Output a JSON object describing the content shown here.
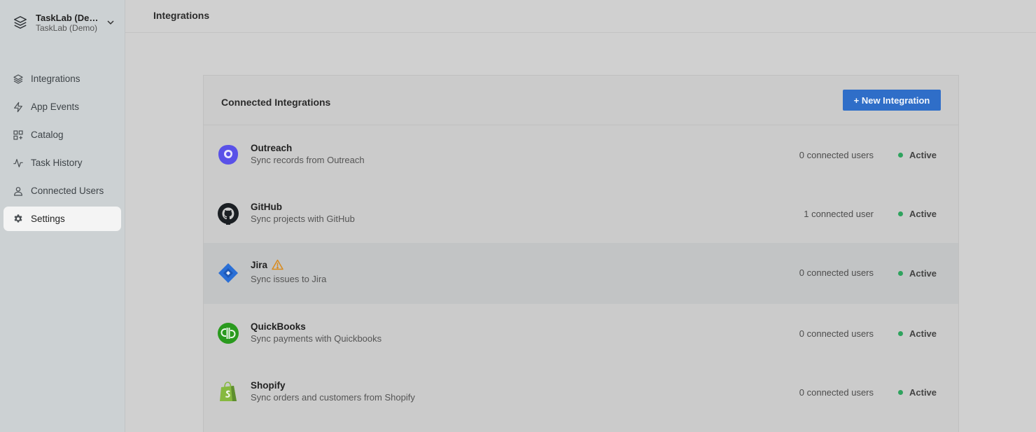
{
  "workspace": {
    "name": "TaskLab (Demo)",
    "subtitle": "TaskLab (Demo)"
  },
  "nav": [
    {
      "label": "Integrations",
      "icon": "layers-icon"
    },
    {
      "label": "App Events",
      "icon": "bolt-icon"
    },
    {
      "label": "Catalog",
      "icon": "grid-add-icon"
    },
    {
      "label": "Task History",
      "icon": "activity-icon"
    },
    {
      "label": "Connected Users",
      "icon": "user-icon"
    },
    {
      "label": "Settings",
      "icon": "gear-icon",
      "active": true
    }
  ],
  "header": {
    "title": "Integrations"
  },
  "card": {
    "title": "Connected Integrations",
    "new_button": "+ New Integration"
  },
  "integrations": [
    {
      "name": "Outreach",
      "description": "Sync records from Outreach",
      "users": "0 connected users",
      "status": "Active",
      "icon": "outreach-logo",
      "color": "#5951e8"
    },
    {
      "name": "GitHub",
      "description": "Sync projects with GitHub",
      "users": "1 connected user",
      "status": "Active",
      "icon": "github-logo",
      "color": "#1b1f23"
    },
    {
      "name": "Jira",
      "description": "Sync issues to Jira",
      "users": "0 connected users",
      "status": "Active",
      "icon": "jira-logo",
      "color": "#2a6fd6",
      "warning": true
    },
    {
      "name": "QuickBooks",
      "description": "Sync payments with Quickbooks",
      "users": "0 connected users",
      "status": "Active",
      "icon": "quickbooks-logo",
      "color": "#2a9a1e"
    },
    {
      "name": "Shopify",
      "description": "Sync orders and customers from Shopify",
      "users": "0 connected users",
      "status": "Active",
      "icon": "shopify-logo",
      "color": "#86b93f"
    }
  ],
  "colors": {
    "accent": "#2f6ec8",
    "status_active": "#2fa35e",
    "warning": "#d98a1c"
  }
}
